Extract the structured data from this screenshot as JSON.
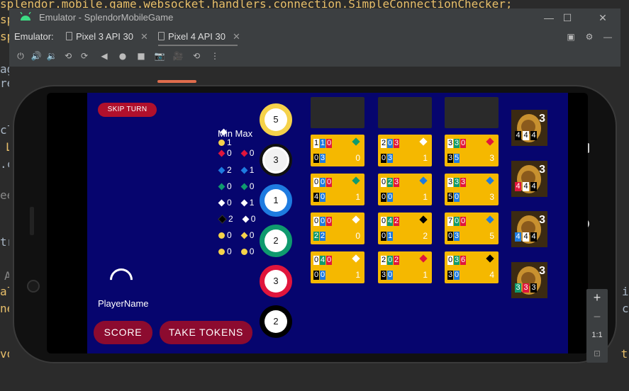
{
  "ide": {
    "code_lines": [
      "splendor.mobile.game.websocket.handlers.connection.SimpleConnectionChecker;",
      "sp",
      "sp",
      "ag",
      "re",
      "cl",
      "L",
      ".c",
      "ee",
      "tr",
      "A",
      "al",
      "ne",
      "vo"
    ],
    "right_fragments": [
      "i",
      "c",
      "ct"
    ]
  },
  "window": {
    "title": "Emulator - SplendorMobileGame",
    "emulator_label": "Emulator:",
    "tabs": [
      {
        "label": "Pixel 3 API 30"
      },
      {
        "label": "Pixel 4 API 30"
      }
    ]
  },
  "zoom": {
    "plus": "+",
    "minus": "−",
    "ratio": "1:1"
  },
  "game": {
    "skip_turn": "SKIP TURN",
    "player_name": "PlayerName",
    "score_button": "SCORE",
    "take_tokens_button": "TAKE TOKENS",
    "min_max_label": "Min Max",
    "colors": {
      "white": "#ffffff",
      "red": "#e0153c",
      "blue": "#1e7be0",
      "green": "#0f9a6e",
      "black": "#000000",
      "gold": "#f5d24a",
      "card": "#f5b800",
      "background": "#06056e"
    },
    "min_max_rows": [
      {
        "min": "1",
        "max": "",
        "left_color": "gold",
        "right_color": ""
      },
      {
        "min": "0",
        "max": "0",
        "left_color": "red",
        "right_color": "red"
      },
      {
        "min": "2",
        "max": "1",
        "left_color": "blue",
        "right_color": "blue"
      },
      {
        "min": "0",
        "max": "0",
        "left_color": "green",
        "right_color": "green"
      },
      {
        "min": "0",
        "max": "1",
        "left_color": "white",
        "right_color": "white"
      },
      {
        "min": "2",
        "max": "0",
        "left_color": "black",
        "right_color": "white"
      },
      {
        "min": "0",
        "max": "0",
        "left_color": "gold",
        "right_color": "gold"
      },
      {
        "min": "0",
        "max": "0",
        "left_color": "gold",
        "right_color": "gold"
      }
    ],
    "tokens": [
      {
        "count": "5",
        "color": "gold"
      },
      {
        "count": "3",
        "color": "white"
      },
      {
        "count": "1",
        "color": "blue"
      },
      {
        "count": "2",
        "color": "green"
      },
      {
        "count": "3",
        "color": "red"
      },
      {
        "count": "2",
        "color": "black"
      }
    ],
    "card_columns": [
      {
        "cards": [
          {
            "top": [
              "1",
              "1",
              "0"
            ],
            "top_colors": [
              "white",
              "blue",
              "red"
            ],
            "bottom": [
              "0",
              "3"
            ],
            "bottom_colors": [
              "black",
              "blue"
            ],
            "points": "0",
            "gem": "green"
          },
          {
            "top": [
              "0",
              "0",
              "0"
            ],
            "top_colors": [
              "white",
              "blue",
              "red"
            ],
            "bottom": [
              "4",
              "0"
            ],
            "bottom_colors": [
              "black",
              "blue"
            ],
            "points": "1",
            "gem": "green"
          },
          {
            "top": [
              "0",
              "0",
              "0"
            ],
            "top_colors": [
              "white",
              "blue",
              "red"
            ],
            "bottom": [
              "2",
              "2"
            ],
            "bottom_colors": [
              "green",
              "blue"
            ],
            "points": "0",
            "gem": "white"
          },
          {
            "top": [
              "0",
              "4",
              "0"
            ],
            "top_colors": [
              "white",
              "green",
              "red"
            ],
            "bottom": [
              "0",
              "0"
            ],
            "bottom_colors": [
              "black",
              "blue"
            ],
            "points": "1",
            "gem": "white"
          }
        ]
      },
      {
        "cards": [
          {
            "top": [
              "2",
              "0",
              "3"
            ],
            "top_colors": [
              "white",
              "blue",
              "red"
            ],
            "bottom": [
              "0",
              "3"
            ],
            "bottom_colors": [
              "black",
              "blue"
            ],
            "points": "1",
            "gem": "white"
          },
          {
            "top": [
              "0",
              "2",
              "3"
            ],
            "top_colors": [
              "white",
              "green",
              "red"
            ],
            "bottom": [
              "0",
              "0"
            ],
            "bottom_colors": [
              "black",
              "blue"
            ],
            "points": "1",
            "gem": "blue"
          },
          {
            "top": [
              "0",
              "4",
              "2"
            ],
            "top_colors": [
              "white",
              "green",
              "red"
            ],
            "bottom": [
              "0",
              "1"
            ],
            "bottom_colors": [
              "black",
              "blue"
            ],
            "points": "2",
            "gem": "black"
          },
          {
            "top": [
              "2",
              "0",
              "2"
            ],
            "top_colors": [
              "white",
              "green",
              "red"
            ],
            "bottom": [
              "3",
              "0"
            ],
            "bottom_colors": [
              "black",
              "blue"
            ],
            "points": "1",
            "gem": "red"
          }
        ]
      },
      {
        "cards": [
          {
            "top": [
              "3",
              "3",
              "0"
            ],
            "top_colors": [
              "white",
              "green",
              "red"
            ],
            "bottom": [
              "3",
              "5"
            ],
            "bottom_colors": [
              "black",
              "blue"
            ],
            "points": "3",
            "gem": "red"
          },
          {
            "top": [
              "3",
              "3",
              "3"
            ],
            "top_colors": [
              "white",
              "green",
              "red"
            ],
            "bottom": [
              "5",
              "0"
            ],
            "bottom_colors": [
              "black",
              "blue"
            ],
            "points": "3",
            "gem": "blue"
          },
          {
            "top": [
              "7",
              "0",
              "0"
            ],
            "top_colors": [
              "white",
              "green",
              "red"
            ],
            "bottom": [
              "0",
              "3"
            ],
            "bottom_colors": [
              "black",
              "blue"
            ],
            "points": "5",
            "gem": "blue"
          },
          {
            "top": [
              "0",
              "3",
              "6"
            ],
            "top_colors": [
              "white",
              "green",
              "red"
            ],
            "bottom": [
              "3",
              "0"
            ],
            "bottom_colors": [
              "black",
              "blue"
            ],
            "points": "4",
            "gem": "black"
          }
        ]
      }
    ],
    "nobles": [
      {
        "points": "3",
        "req": [
          "4",
          "4",
          "4"
        ],
        "req_colors": [
          "black",
          "white",
          "black"
        ]
      },
      {
        "points": "3",
        "req": [
          "4",
          "4",
          "4"
        ],
        "req_colors": [
          "red",
          "white",
          "black"
        ]
      },
      {
        "points": "3",
        "req": [
          "4",
          "4",
          "4"
        ],
        "req_colors": [
          "blue",
          "white",
          "black"
        ]
      },
      {
        "points": "3",
        "req": [
          "3",
          "3",
          "3"
        ],
        "req_colors": [
          "green",
          "red",
          "black"
        ]
      }
    ]
  }
}
